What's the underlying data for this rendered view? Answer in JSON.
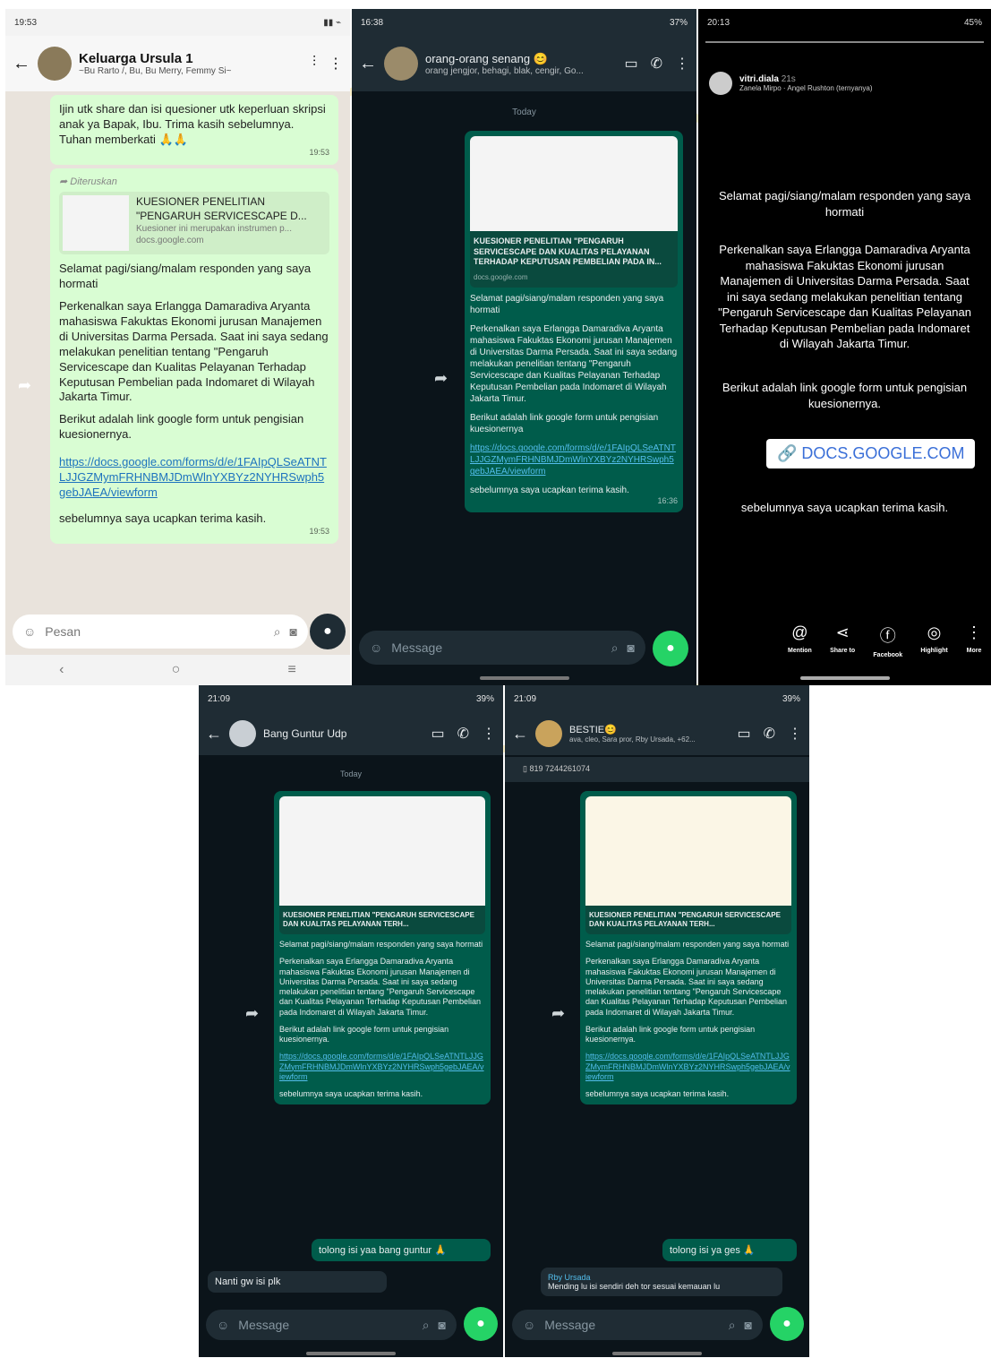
{
  "panel1": {
    "status_time": "19:53",
    "chat_name": "Keluarga Ursula 1",
    "chat_sub": "~Bu Rarto /, Bu, Bu Merry, Femmy Si~",
    "msg1": "Ijin utk share dan isi quesioner utk keperluan skripsi anak ya Bapak, Ibu. Trima kasih sebelumnya. Tuhan memberkati 🙏🙏",
    "msg1_time": "19:53",
    "forwarded": "Diteruskan",
    "doc_title": "KUESIONER PENELITIAN \"PENGARUH SERVICESCAPE D...",
    "doc_sub": "Kuesioner ini merupakan instrumen p...",
    "doc_domain": "docs.google.com",
    "p1": "Selamat pagi/siang/malam responden yang saya hormati",
    "p2": "Perkenalkan saya Erlangga Damaradiva Aryanta mahasiswa Fakuktas Ekonomi jurusan Manajemen di Universitas Darma Persada. Saat ini saya sedang melakukan penelitian tentang \"Pengaruh Servicescape dan Kualitas Pelayanan Terhadap Keputusan Pembelian pada Indomaret di Wilayah Jakarta Timur.",
    "p3": "Berikut adalah link google form untuk pengisian kuesionernya.",
    "link": "https://docs.google.com/forms/d/e/1FAIpQLSeATNTLJJGZMymFRHNBMJDmWlnYXBYz2NYHRSwph5gebJAEA/viewform",
    "p4": "sebelumnya saya ucapkan terima kasih.",
    "msg2_time": "19:53",
    "input_placeholder": "Pesan"
  },
  "panel2": {
    "status_time": "16:38",
    "status_battery": "37%",
    "chat_name": "orang-orang senang 😊",
    "chat_sub": "orang jengjor, behagi, blak, cengir, Go...",
    "date_chip": "Today",
    "doc_title": "KUESIONER PENELITIAN \"PENGARUH SERVICESCAPE DAN KUALITAS PELAYANAN TERHADAP KEPUTUSAN PEMBELIAN PADA IN...",
    "doc_domain": "docs.google.com",
    "p1": "Selamat pagi/siang/malam responden yang saya hormati",
    "p2": "Perkenalkan saya Erlangga Damaradiva Aryanta mahasiswa Fakuktas Ekonomi jurusan Manajemen di Universitas Darma Persada. Saat ini saya sedang melakukan penelitian tentang \"Pengaruh Servicescape dan Kualitas Pelayanan Terhadap Keputusan Pembelian pada Indomaret di Wilayah Jakarta Timur.",
    "p3": "Berikut adalah link google form untuk pengisian kuesionernya",
    "link": "https://docs.google.com/forms/d/e/1FAIpQLSeATNTLJJGZMymFRHNBMJDmWlnYXBYz2NYHRSwph5gebJAEA/viewform",
    "p4": "sebelumnya saya ucapkan terima kasih.",
    "msg_time": "16:36",
    "input_placeholder": "Message"
  },
  "panel3": {
    "status_time": "20:13",
    "status_battery": "45%",
    "user": "vitri.diala",
    "user_time": "21s",
    "song": "Zanela Mirpo · Angel Rushton (ternyanya)",
    "t1": "Selamat pagi/siang/malam responden yang saya hormati",
    "t2": "Perkenalkan saya Erlangga Damaradiva Aryanta mahasiswa Fakuktas Ekonomi jurusan Manajemen di Universitas Darma Persada. Saat ini saya sedang melakukan penelitian tentang \"Pengaruh Servicescape dan Kualitas Pelayanan Terhadap Keputusan Pembelian pada Indomaret di Wilayah Jakarta Timur.",
    "t3": "Berikut adalah link google form untuk pengisian kuesionernya.",
    "sticker": "DOCS.GOOGLE.COM",
    "t4": "sebelumnya saya ucapkan terima kasih.",
    "btn1": "Mention",
    "btn2": "Share to",
    "btn3": "Facebook",
    "btn4": "Highlight",
    "btn5": "More"
  },
  "panel4": {
    "status_time": "21:09",
    "status_battery": "39%",
    "chat_name": "Bang Guntur Udp",
    "date_chip": "Today",
    "doc_title": "KUESIONER PENELITIAN \"PENGARUH SERVICESCAPE DAN KUALITAS PELAYANAN TERH...",
    "p1": "Selamat pagi/siang/malam responden yang saya hormati",
    "p2": "Perkenalkan saya Erlangga Damaradiva Aryanta mahasiswa Fakuktas Ekonomi jurusan Manajemen di Universitas Darma Persada. Saat ini saya sedang melakukan penelitian tentang \"Pengaruh Servicescape dan Kualitas Pelayanan Terhadap Keputusan Pembelian pada Indomaret di Wilayah Jakarta Timur.",
    "p3": "Berikut adalah link google form untuk pengisian kuesionernya.",
    "link": "https://docs.google.com/forms/d/e/1FAIpQLSeATNTLJJGZMymFRHNBMJDmWlnYXBYz2NYHRSwph5gebJAEA/viewform",
    "p4": "sebelumnya saya ucapkan terima kasih.",
    "reply_out": "tolong isi yaa bang guntur 🙏",
    "reply_in": "Nanti gw isi plk",
    "input_placeholder": "Message"
  },
  "panel5": {
    "status_time": "21:09",
    "status_battery": "39%",
    "chat_name": "BESTIE😊",
    "chat_sub": "ava, cleo, Sara pror, Rby Ursada, +62...",
    "pinned": "819 7244261074",
    "doc_title": "KUESIONER PENELITIAN \"PENGARUH SERVICESCAPE DAN KUALITAS PELAYANAN TERH...",
    "p1": "Selamat pagi/siang/malam responden yang saya hormati",
    "p2": "Perkenalkan saya Erlangga Damaradiva Aryanta mahasiswa Fakuktas Ekonomi jurusan Manajemen di Universitas Darma Persada. Saat ini saya sedang melakukan penelitian tentang \"Pengaruh Servicescape dan Kualitas Pelayanan Terhadap Keputusan Pembelian pada Indomaret di Wilayah Jakarta Timur.",
    "p3": "Berikut adalah link google form untuk pengisian kuesionernya.",
    "link": "https://docs.google.com/forms/d/e/1FAIpQLSeATNTLJJGZMymFRHNBMJDmWlnYXBYz2NYHRSwph5gebJAEA/viewform",
    "p4": "sebelumnya saya ucapkan terima kasih.",
    "reply_out": "tolong isi ya ges 🙏",
    "reply_name": "Rby Ursada",
    "reply_in": "Mending lu isi sendiri deh tor sesuai kemauan lu",
    "input_placeholder": "Message"
  }
}
